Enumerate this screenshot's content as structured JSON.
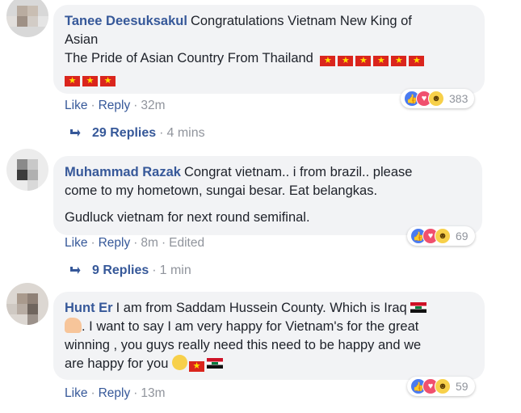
{
  "comments": [
    {
      "author": "Tanee Deesuksakul",
      "line1": "Congratulations Vietnam New King of",
      "line2": "Asian",
      "line3": "The Pride of Asian Country From Thailand",
      "actions": {
        "like": "Like",
        "reply": "Reply",
        "time": "32m"
      },
      "reactions": {
        "count": "383",
        "types": [
          "like-icon",
          "love-icon",
          "haha-icon"
        ]
      },
      "replies": {
        "label": "29 Replies",
        "time": "4 mins"
      }
    },
    {
      "author": "Muhammad Razak",
      "line1": "Congrat vietnam.. i from brazil.. please",
      "line2": "come to my hometown, sungai besar. Eat belangkas.",
      "line3": "Gudluck vietnam for next round semifinal.",
      "actions": {
        "like": "Like",
        "reply": "Reply",
        "time": "8m",
        "edited": "Edited"
      },
      "reactions": {
        "count": "69",
        "types": [
          "like-icon",
          "love-icon",
          "haha-icon"
        ]
      },
      "replies": {
        "label": "9 Replies",
        "time": "1 min"
      }
    },
    {
      "author": "Hunt Er",
      "line1": "I am from Saddam Hussein County. Which is Iraq",
      "line2": ". I want to say I am very happy for Vietnam's for the great",
      "line3": "winning , you guys really need this need to be happy and we",
      "line4": "are happy for you",
      "actions": {
        "like": "Like",
        "reply": "Reply",
        "time": "13m"
      },
      "reactions": {
        "count": "59",
        "types": [
          "like-icon",
          "love-icon",
          "haha-icon"
        ]
      }
    }
  ],
  "ui": {
    "separator": "·",
    "flag_star": "★"
  },
  "colors": {
    "link": "#365899",
    "meta": "#90949c",
    "bubble": "#f2f3f5",
    "vn_red": "#da251d",
    "vn_star": "#ffde00"
  }
}
